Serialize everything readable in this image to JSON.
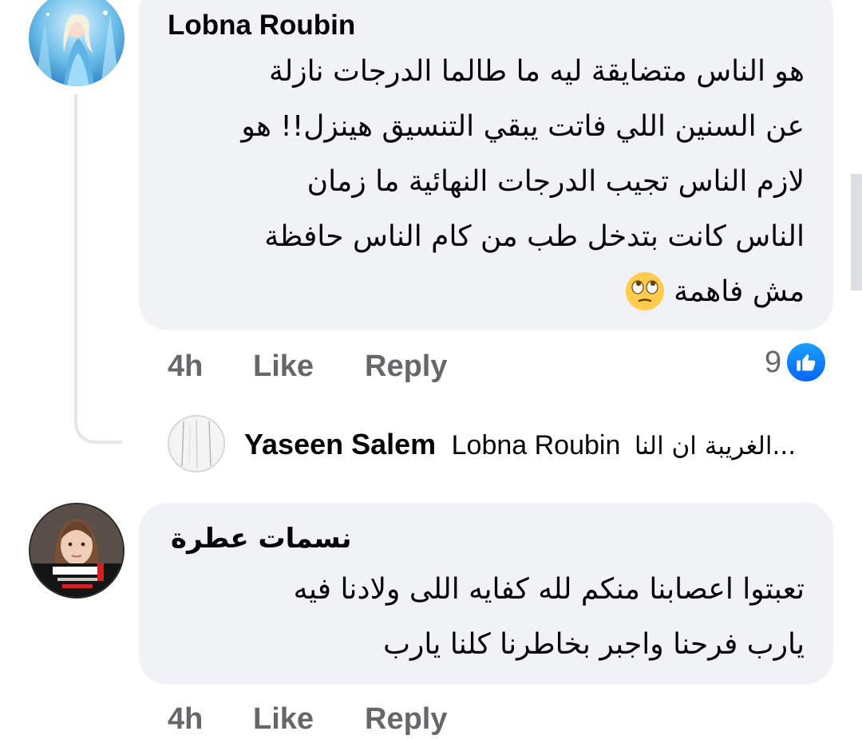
{
  "comments": [
    {
      "author": "Lobna Roubin",
      "lines": [
        "هو الناس متضايقة ليه ما طالما الدرجات نازلة",
        "عن السنين اللي فاتت يبقي التنسيق هينزل!! هو",
        "لازم الناس تجيب الدرجات النهائية ما زمان",
        "الناس كانت بتدخل طب من كام الناس حافظة",
        "مش فاهمة"
      ],
      "emoji": "face-with-rolling-eyes",
      "time": "4h",
      "like_label": "Like",
      "reply_label": "Reply",
      "reaction_count": "9",
      "reaction_icon": "thumbs-up-icon"
    },
    {
      "author": "نسمات عطرة",
      "lines": [
        "تعبتوا اعصابنا منكم لله كفايه اللى ولادنا فيه",
        "يارب فرحنا واجبر بخاطرنا كلنا يارب"
      ],
      "time": "4h",
      "like_label": "Like",
      "reply_label": "Reply"
    }
  ],
  "reply_preview": {
    "author": "Yaseen Salem",
    "tagged": "Lobna Roubin",
    "snippet": "الغريبة ان النا..."
  },
  "colors": {
    "bubble": "#f0f2f5",
    "action_text": "#65676b",
    "like_blue": "#0866ff",
    "thread_line": "#e4e6eb"
  }
}
